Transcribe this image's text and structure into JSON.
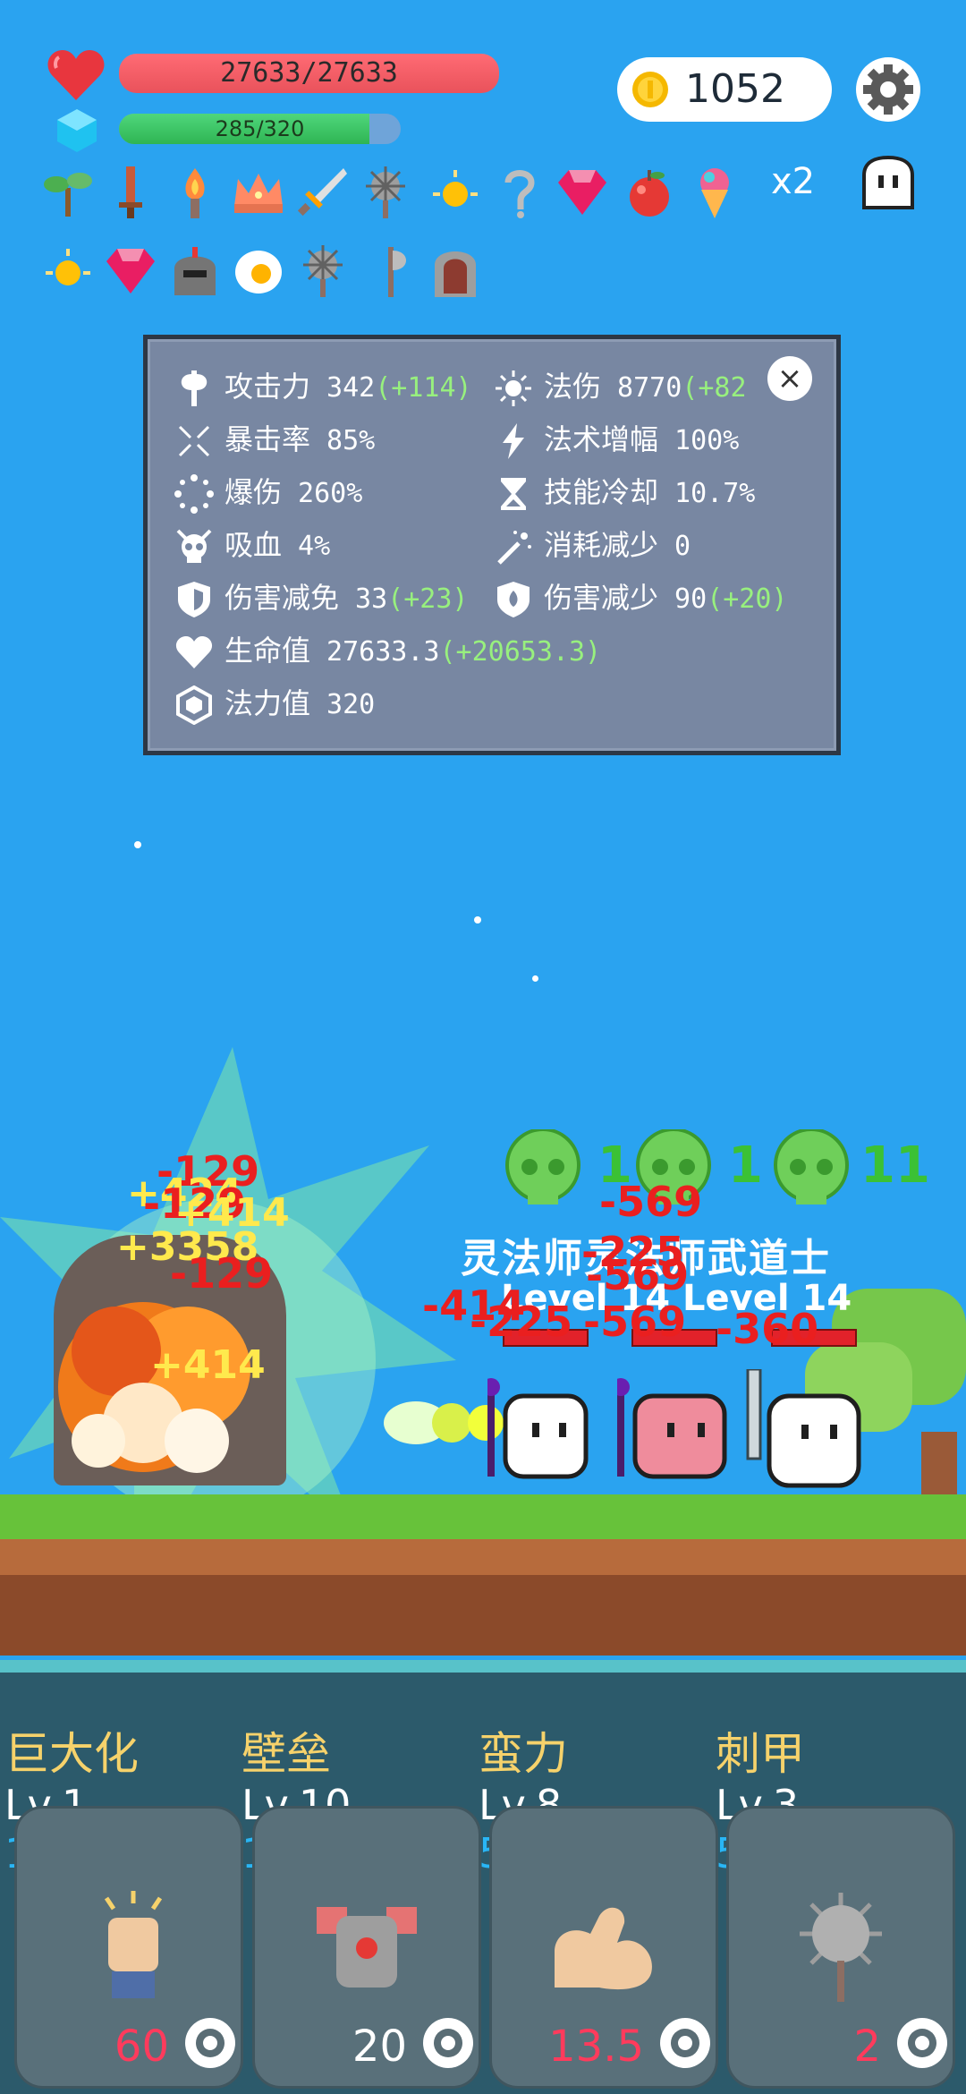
{
  "hud": {
    "hp_text": "27633/27633",
    "hp_fraction": 1.0,
    "mp_text": "285/320",
    "mp_fraction": 0.89,
    "coins": "1052",
    "multiplier": "x2"
  },
  "items_row1": [
    "sapling-icon",
    "sword-icon",
    "torch-icon",
    "crown-icon",
    "broadsword-icon",
    "spiked-mace-icon",
    "sun-gem-icon",
    "hook-icon",
    "ruby-icon",
    "apple-icon",
    "ice-cream-icon"
  ],
  "items_row2": [
    "sun-gem-icon",
    "ruby-icon",
    "helmet-icon",
    "fried-egg-icon",
    "spiked-mace-icon",
    "axe-icon",
    "tombstone-icon"
  ],
  "stats": {
    "atk_label": "攻击力",
    "atk_value": "342",
    "atk_bonus": "(+114)",
    "magic_label": "法伤",
    "magic_value": "8770",
    "magic_bonus": "(+82",
    "crit_label": "暴击率",
    "crit_value": "85%",
    "spell_amp_label": "法术增幅",
    "spell_amp_value": "100%",
    "critdmg_label": "爆伤",
    "critdmg_value": "260%",
    "cooldown_label": "技能冷却",
    "cooldown_value": "10.7%",
    "lifesteal_label": "吸血",
    "lifesteal_value": "4%",
    "cost_label": "消耗减少",
    "cost_value": "0",
    "dmg_reduce_label": "伤害减免",
    "dmg_reduce_value": "33",
    "dmg_reduce_bonus": "(+23)",
    "dmg_less_label": "伤害减少",
    "dmg_less_value": "90",
    "dmg_less_bonus": "(+20)",
    "hp_label": "生命值",
    "hp_value": "27633.3",
    "hp_bonus": "(+20653.3)",
    "mana_label": "法力值",
    "mana_value": "320",
    "close": "×"
  },
  "battle": {
    "floating": [
      {
        "text": "-129",
        "kind": "dmg"
      },
      {
        "text": "+424",
        "kind": "heal"
      },
      {
        "text": "-129",
        "kind": "dmg"
      },
      {
        "text": "+414",
        "kind": "heal"
      },
      {
        "text": "+3358",
        "kind": "heal"
      },
      {
        "text": "-129",
        "kind": "dmg"
      },
      {
        "text": "+414",
        "kind": "heal"
      },
      {
        "text": "-569",
        "kind": "dmg"
      },
      {
        "text": "-225",
        "kind": "dmg"
      },
      {
        "text": "-569",
        "kind": "dmg"
      },
      {
        "text": "-414",
        "kind": "dmg"
      },
      {
        "text": "-225",
        "kind": "dmg"
      },
      {
        "text": "-569",
        "kind": "dmg"
      },
      {
        "text": "-360",
        "kind": "dmg"
      }
    ],
    "skull_count_1": "1",
    "skull_count_2": "1",
    "skull_count_3": "11",
    "enemy_names": "灵法师灵法师武道士",
    "enemy_levels": "Level 14  Level 14"
  },
  "skills": [
    {
      "name": "巨大化",
      "level": "Lv.1",
      "cost": "15",
      "cooldown": "60",
      "icon": "fist-icon"
    },
    {
      "name": "壁垒",
      "level": "Lv.10",
      "cost": "10",
      "cooldown": "20",
      "icon": "armor-icon"
    },
    {
      "name": "蛮力",
      "level": "Lv.8",
      "cost": "5",
      "cooldown": "13.5",
      "icon": "muscle-icon"
    },
    {
      "name": "刺甲",
      "level": "Lv.3",
      "cost": "5",
      "cooldown": "2",
      "icon": "spiked-ball-icon"
    }
  ]
}
